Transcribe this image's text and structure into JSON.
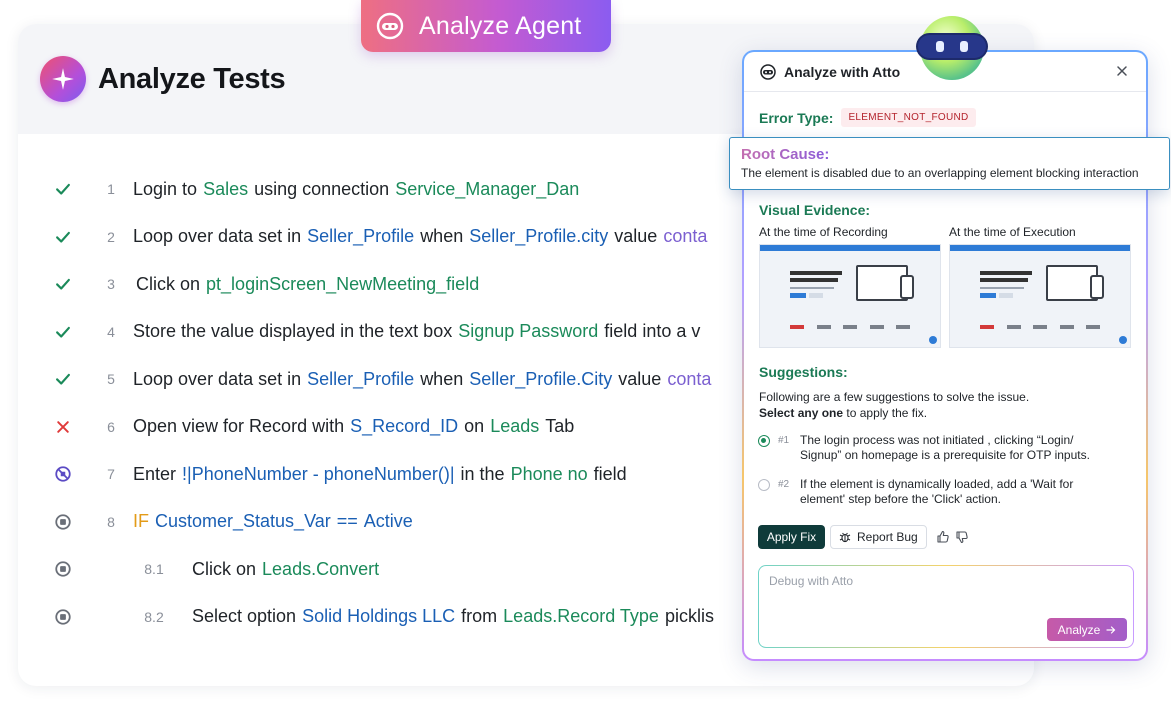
{
  "agent_pill": {
    "label": "Analyze Agent",
    "icon": "robot-mask-icon"
  },
  "tests": {
    "title": "Analyze Tests",
    "steps": [
      {
        "num": "1",
        "status": "passed",
        "tokens": [
          {
            "t": "Login to",
            "c": ""
          },
          {
            "t": "Sales",
            "c": "green"
          },
          {
            "t": "using connection",
            "c": ""
          },
          {
            "t": "Service_Manager_Dan",
            "c": "green"
          }
        ]
      },
      {
        "num": "2",
        "status": "passed",
        "tokens": [
          {
            "t": "Loop over data set in",
            "c": ""
          },
          {
            "t": "Seller_Profile",
            "c": "blue"
          },
          {
            "t": "when",
            "c": ""
          },
          {
            "t": "Seller_Profile.city",
            "c": "blue"
          },
          {
            "t": "value",
            "c": ""
          },
          {
            "t": "conta",
            "c": "purple"
          }
        ]
      },
      {
        "num": "3",
        "status": "passed",
        "tokens": [
          {
            "t": "Click on",
            "c": ""
          },
          {
            "t": "pt_loginScreen_NewMeeting_field",
            "c": "green"
          }
        ]
      },
      {
        "num": "4",
        "status": "passed",
        "tokens": [
          {
            "t": "Store the value displayed in the text box",
            "c": ""
          },
          {
            "t": "Signup Password",
            "c": "green"
          },
          {
            "t": "field into a v",
            "c": ""
          }
        ]
      },
      {
        "num": "5",
        "status": "passed",
        "tokens": [
          {
            "t": "Loop over data set in",
            "c": ""
          },
          {
            "t": "Seller_Profile",
            "c": "blue"
          },
          {
            "t": "when",
            "c": ""
          },
          {
            "t": "Seller_Profile.City",
            "c": "blue"
          },
          {
            "t": "value",
            "c": ""
          },
          {
            "t": "conta",
            "c": "purple"
          }
        ]
      },
      {
        "num": "6",
        "status": "failed",
        "tokens": [
          {
            "t": "Open view for Record with",
            "c": ""
          },
          {
            "t": "S_Record_ID",
            "c": "blue"
          },
          {
            "t": "on",
            "c": ""
          },
          {
            "t": "Leads",
            "c": "green"
          },
          {
            "t": "Tab",
            "c": ""
          }
        ]
      },
      {
        "num": "7",
        "status": "skipped",
        "tokens": [
          {
            "t": "Enter",
            "c": ""
          },
          {
            "t": "!|PhoneNumber - phoneNumber()|",
            "c": "blue"
          },
          {
            "t": "in the",
            "c": ""
          },
          {
            "t": "Phone no",
            "c": "green"
          },
          {
            "t": "field",
            "c": ""
          }
        ]
      },
      {
        "num": "8",
        "status": "stopped",
        "tokens": [
          {
            "t": "IF",
            "c": "orange"
          },
          {
            "t": "Customer_Status_Var",
            "c": "blue"
          },
          {
            "t": "==",
            "c": "blue"
          },
          {
            "t": "Active",
            "c": "blue"
          }
        ]
      },
      {
        "num": "8.1",
        "status": "stopped",
        "sub": true,
        "tokens": [
          {
            "t": "Click on",
            "c": ""
          },
          {
            "t": "Leads.Convert",
            "c": "green"
          }
        ]
      },
      {
        "num": "8.2",
        "status": "stopped",
        "sub": true,
        "tokens": [
          {
            "t": "Select option",
            "c": ""
          },
          {
            "t": "Solid Holdings LLC",
            "c": "blue"
          },
          {
            "t": "from",
            "c": ""
          },
          {
            "t": "Leads.Record Type",
            "c": "green"
          },
          {
            "t": "picklis",
            "c": ""
          }
        ]
      }
    ]
  },
  "atto": {
    "title": "Analyze with Atto",
    "error_type_label": "Error Type:",
    "error_type_value": "ELEMENT_NOT_FOUND",
    "root_cause_title": "Root Cause:",
    "root_cause_text": "The element is disabled due to an overlapping element blocking interaction",
    "visual_evidence_label": "Visual Evidence:",
    "recording_caption": "At the time of Recording",
    "execution_caption": "At the time of Execution",
    "suggestions_label": "Suggestions:",
    "suggestions_intro": "Following are a few suggestions to solve the issue.",
    "select_bold": "Select any one",
    "select_rest": " to apply the fix.",
    "options": [
      {
        "num": "#1",
        "text": "The login process was not initiated , clicking “Login/ Signup” on homepage is a prerequisite for OTP inputs.",
        "selected": true
      },
      {
        "num": "#2",
        "text": "If the element is dynamically loaded, add a 'Wait for element' step before the 'Click' action.",
        "selected": false
      }
    ],
    "apply_fix_label": "Apply Fix",
    "report_bug_label": "Report Bug",
    "debug_placeholder": "Debug with Atto",
    "analyze_label": "Analyze"
  },
  "colors": {
    "green": "#1b8a5a",
    "blue": "#1a5fb4",
    "purple": "#7b5fd0",
    "orange": "#e39b18",
    "failed": "#e03a3a",
    "skipped": "#5b4bc4",
    "stopped": "#6a6f78"
  }
}
